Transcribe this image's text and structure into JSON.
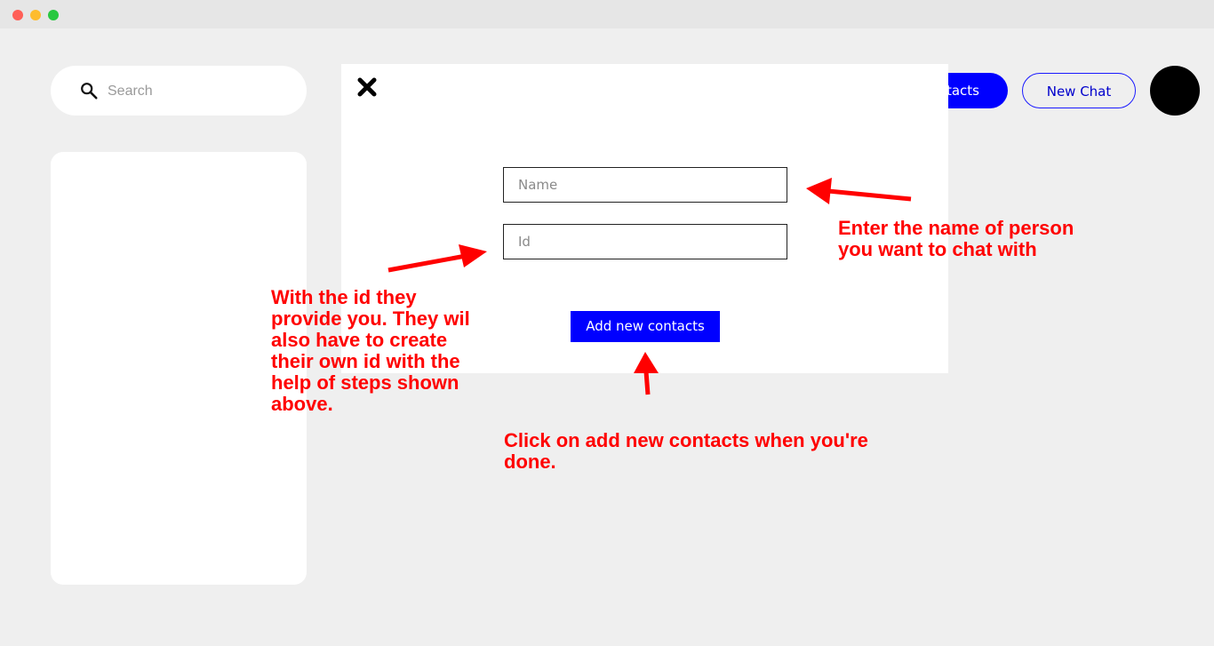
{
  "window": {
    "controls": [
      "close",
      "minimize",
      "maximize"
    ]
  },
  "search": {
    "placeholder": "Search",
    "icon": "search-icon"
  },
  "header": {
    "contacts_button_label": "Contacts",
    "new_chat_label": "New Chat",
    "avatar_color": "#000000"
  },
  "modal": {
    "close_icon": "close-icon",
    "name_placeholder": "Name",
    "id_placeholder": "Id",
    "add_button_label": "Add new contacts"
  },
  "annotations": {
    "name_note": "Enter the name of person you want to chat with",
    "id_note": "With the id they provide you. They wil also have to create their own id with the help of steps shown above.",
    "add_note": "Click on add new contacts when you're done.",
    "color": "#ff0000"
  },
  "colors": {
    "accent": "#0000ff",
    "background": "#efefef",
    "panel": "#ffffff"
  }
}
